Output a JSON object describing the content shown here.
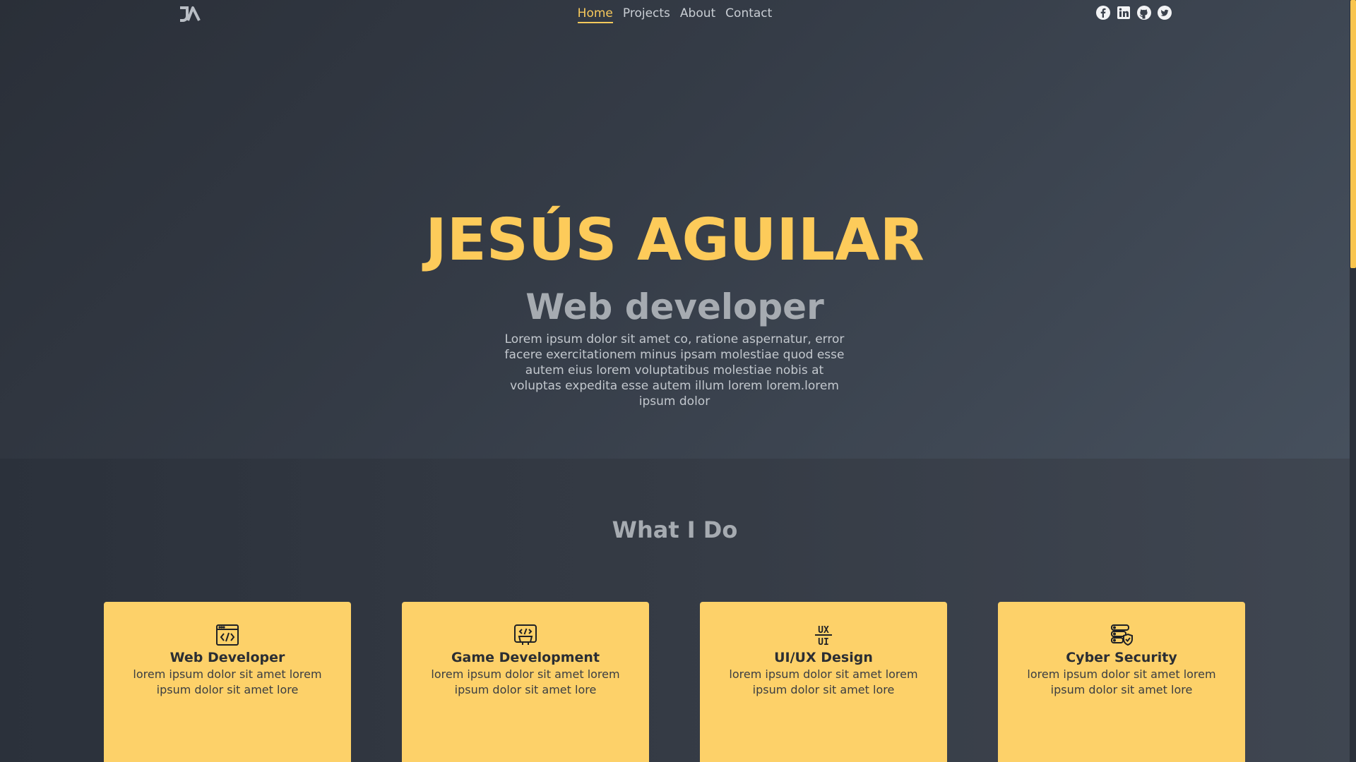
{
  "nav": {
    "logo_icon": "ja-logo-icon",
    "links": [
      {
        "label": "Home",
        "active": true
      },
      {
        "label": "Projects",
        "active": false
      },
      {
        "label": "About",
        "active": false
      },
      {
        "label": "Contact",
        "active": false
      }
    ],
    "socials": [
      "facebook-icon",
      "linkedin-icon",
      "github-icon",
      "twitter-icon"
    ]
  },
  "hero": {
    "name": "JESÚS AGUILAR",
    "role": "Web developer",
    "description": "Lorem ipsum dolor sit amet co, ratione aspernatur, error facere exercitationem minus ipsam molestiae quod esse autem eius lorem voluptatibus molestiae nobis at voluptas expedita esse autem illum lorem lorem.lorem ipsum dolor"
  },
  "services": {
    "title": "What I Do",
    "cards": [
      {
        "title": "Web Developer",
        "desc": "lorem ipsum dolor sit amet lorem ipsum dolor sit amet lore",
        "icon": "code-window-icon"
      },
      {
        "title": "Game Development",
        "desc": "lorem ipsum dolor sit amet lorem ipsum dolor sit amet lore",
        "icon": "game-code-icon"
      },
      {
        "title": "UI/UX Design",
        "desc": "lorem ipsum dolor sit amet lorem ipsum dolor sit amet lore",
        "icon": "ux-ui-icon"
      },
      {
        "title": "Cyber Security",
        "desc": "lorem ipsum dolor sit amet lorem ipsum dolor sit amet lore",
        "icon": "server-shield-icon"
      }
    ]
  },
  "colors": {
    "accent": "#fdcb5a",
    "card": "#fdd169",
    "muted": "#a6abb1"
  }
}
